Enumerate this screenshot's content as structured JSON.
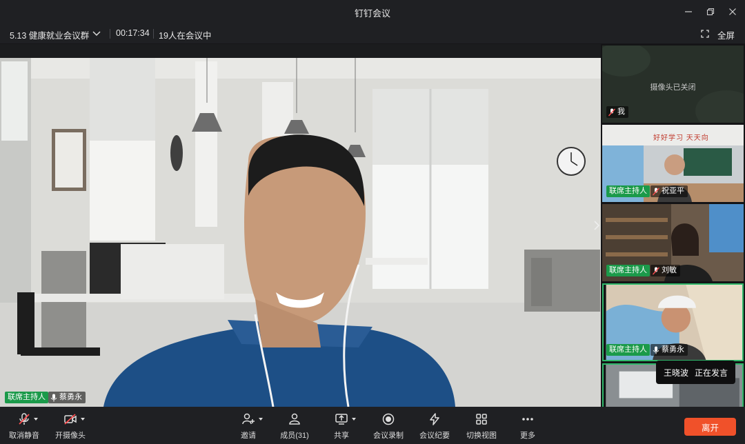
{
  "window": {
    "title": "钉钉会议"
  },
  "infobar": {
    "meeting_name": "5.13 健康就业会议群",
    "timer": "00:17:34",
    "participant_count": "19人在会议中",
    "fullscreen_label": "全屏"
  },
  "main_video": {
    "host_badge": "联席主持人",
    "speaker_name": "蔡勇永"
  },
  "side_tiles": [
    {
      "camera_off_text": "摄像头已关闭",
      "name": "我",
      "mic": "muted"
    },
    {
      "host_badge": "联席主持人",
      "name": "祝亚平",
      "mic": "muted",
      "banner_text": "好好学习 天天向"
    },
    {
      "host_badge": "联席主持人",
      "name": "刘敏",
      "mic": "muted"
    },
    {
      "host_badge": "联席主持人",
      "name": "蔡勇永",
      "mic": "on"
    }
  ],
  "speaking": {
    "name": "王晓波",
    "status": "正在发言"
  },
  "toolbar": {
    "unmute": "取消静音",
    "camera_on": "开摄像头",
    "invite": "邀请",
    "members": "成员(31)",
    "share": "共享",
    "record": "会议录制",
    "minutes": "会议纪要",
    "switch_view": "切换视图",
    "more": "更多",
    "leave": "离开"
  },
  "colors": {
    "host_badge": "#1b9a4a",
    "leave_button": "#f0512a",
    "background": "#1b1c1e"
  }
}
